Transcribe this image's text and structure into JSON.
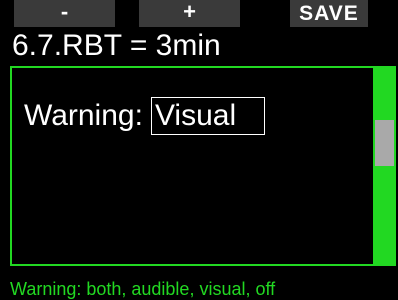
{
  "softkeys": {
    "minus_label": "-",
    "plus_label": "+",
    "save_label": "SAVE"
  },
  "menu": {
    "title": "6.7.RBT = 3min"
  },
  "setting": {
    "label": "Warning:",
    "value": "Visual"
  },
  "help": {
    "text": "Warning: both, audible, visual, off"
  },
  "colors": {
    "accent": "#22d822",
    "softkey_background": "#3a3a3a",
    "scroll_thumb": "#a9a9a9",
    "background": "#000000",
    "text": "#ffffff"
  }
}
